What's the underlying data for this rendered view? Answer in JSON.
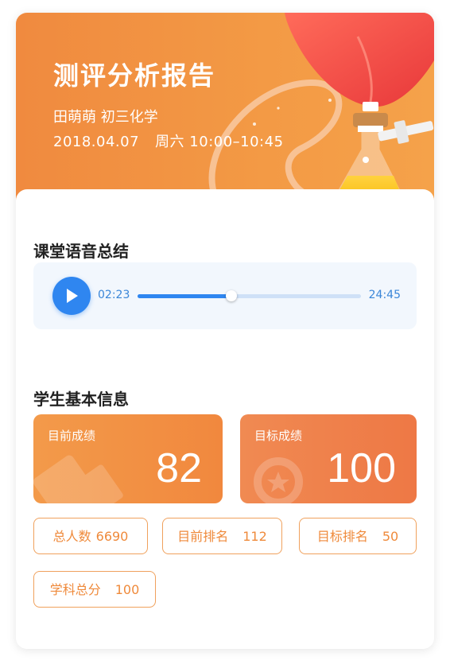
{
  "header": {
    "title": "测评分析报告",
    "student_line": "田萌萌 初三化学",
    "date": "2018.04.07",
    "weekday_time": "周六 10:00–10:45"
  },
  "audio": {
    "section_title": "课堂语音总结",
    "current_time": "02:23",
    "total_time": "24:45",
    "progress": 0.42,
    "play_icon": "play-icon"
  },
  "info": {
    "section_title": "学生基本信息",
    "current_score": {
      "label": "目前成绩",
      "value": "82"
    },
    "target_score": {
      "label": "目标成绩",
      "value": "100"
    },
    "chips": [
      {
        "label": "总人数",
        "value": "6690"
      },
      {
        "label": "目前排名",
        "value": "112"
      },
      {
        "label": "目标排名",
        "value": "50"
      },
      {
        "label": "学科总分",
        "value": "100"
      }
    ]
  },
  "colors": {
    "accent_blue": "#2f86f0",
    "accent_orange": "#f08a3f"
  }
}
